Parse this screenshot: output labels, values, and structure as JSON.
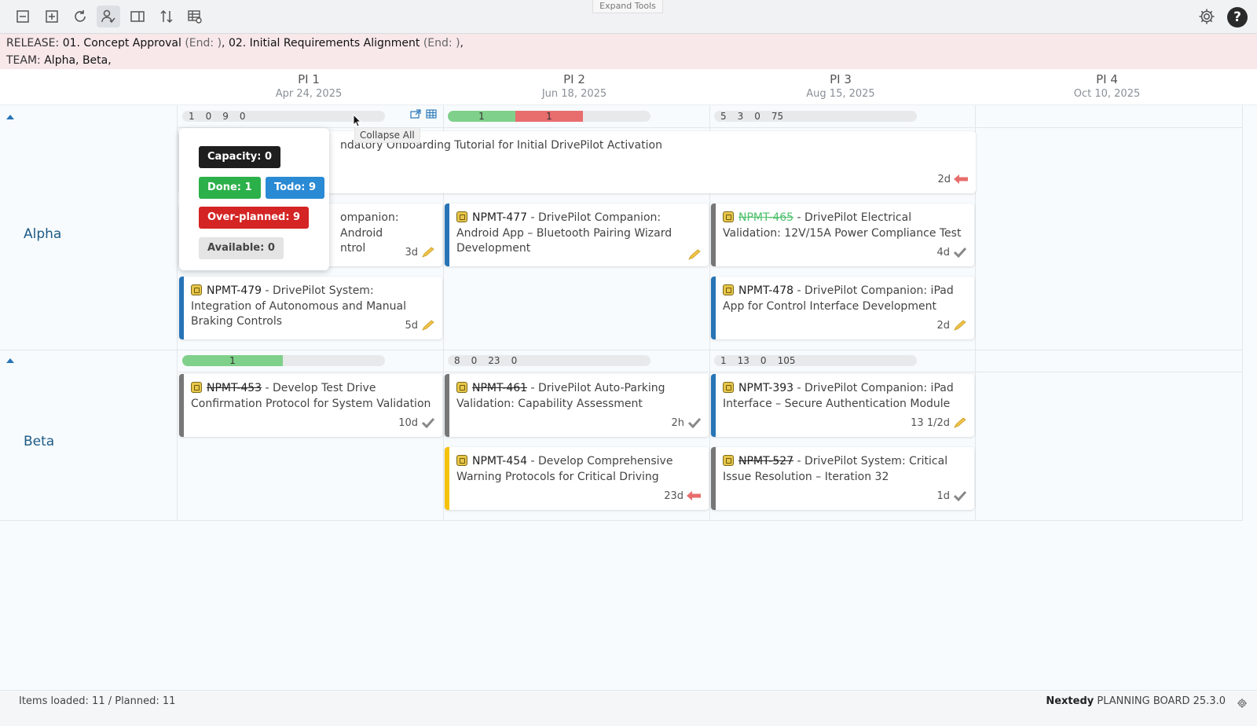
{
  "toolbar": {
    "expand_tools_label": "Expand Tools",
    "help_label": "?"
  },
  "filter": {
    "release_label": "RELEASE:",
    "release_1": "01. Concept Approval",
    "release_1_end": "(End: )",
    "release_2": "02. Initial Requirements Alignment",
    "release_2_end": "(End: )",
    "team_label": "TEAM:",
    "teams": "Alpha, Beta,"
  },
  "pis": [
    {
      "name": "PI 1",
      "date": "Apr 24, 2025"
    },
    {
      "name": "PI 2",
      "date": "Jun 18, 2025"
    },
    {
      "name": "PI 3",
      "date": "Aug 15, 2025"
    },
    {
      "name": "PI 4",
      "date": "Oct 10, 2025"
    }
  ],
  "teams": [
    {
      "name": "Alpha"
    },
    {
      "name": "Beta"
    }
  ],
  "capacity": {
    "alpha_pi1": [
      "1",
      "0",
      "9",
      "0"
    ],
    "alpha_pi2": {
      "green": "1",
      "red": "1"
    },
    "alpha_pi3": [
      "5",
      "3",
      "0",
      "75"
    ],
    "beta_pi1": {
      "green": "1"
    },
    "beta_pi2": [
      "8",
      "0",
      "23",
      "0"
    ],
    "beta_pi3": [
      "1",
      "13",
      "0",
      "105"
    ]
  },
  "popover": {
    "capacity": "Capacity: 0",
    "done": "Done: 1",
    "todo": "Todo: 9",
    "overplanned": "Over-planned: 9",
    "available": "Available: 0"
  },
  "tooltip": "Collapse All",
  "cards": {
    "onboarding": {
      "title": "ndatory Onboarding Tutorial for Initial DrivePilot Activation",
      "est": "2d"
    },
    "android_partial": {
      "title_line1": "ompanion: Android",
      "title_line2": "ntrol",
      "est": "3d"
    },
    "c477": {
      "key": "NPMT-477",
      "title": " - DrivePilot Companion: Android App – Bluetooth Pairing Wizard Development",
      "est": ""
    },
    "c465": {
      "key": "NPMT-465",
      "title": " - DrivePilot Electrical Validation: 12V/15A Power Compliance Test",
      "est": "4d"
    },
    "c479": {
      "key": "NPMT-479",
      "title": " - DrivePilot System: Integration of Autonomous and Manual Braking Controls",
      "est": "5d"
    },
    "c478": {
      "key": "NPMT-478",
      "title": " - DrivePilot Companion: iPad App for Control Interface Development",
      "est": "2d"
    },
    "c453": {
      "key": "NPMT-453",
      "title": " - Develop Test Drive Confirmation Protocol for System Validation",
      "est": "10d"
    },
    "c461": {
      "key": "NPMT-461",
      "title": " - DrivePilot Auto-Parking Validation: Capability Assessment",
      "est": "2h"
    },
    "c393": {
      "key": "NPMT-393",
      "title": " - DrivePilot Companion: iPad Interface – Secure Authentication Module",
      "est": "13 1/2d"
    },
    "c454": {
      "key": "NPMT-454",
      "title": " - Develop Comprehensive Warning Protocols for Critical Driving",
      "est": "23d"
    },
    "c527": {
      "key": "NPMT-527",
      "title": " - DrivePilot System: Critical Issue Resolution – Iteration 32",
      "est": "1d"
    }
  },
  "footer": {
    "items_loaded": "Items loaded: 11 / Planned: 11",
    "brand": "Nextedy",
    "product": "PLANNING BOARD",
    "version": "25.3.0"
  },
  "colors": {
    "accent": "#2774b6",
    "done_green": "#2cb04a",
    "over_red": "#d42424",
    "todo_blue": "#2a8ad4"
  }
}
